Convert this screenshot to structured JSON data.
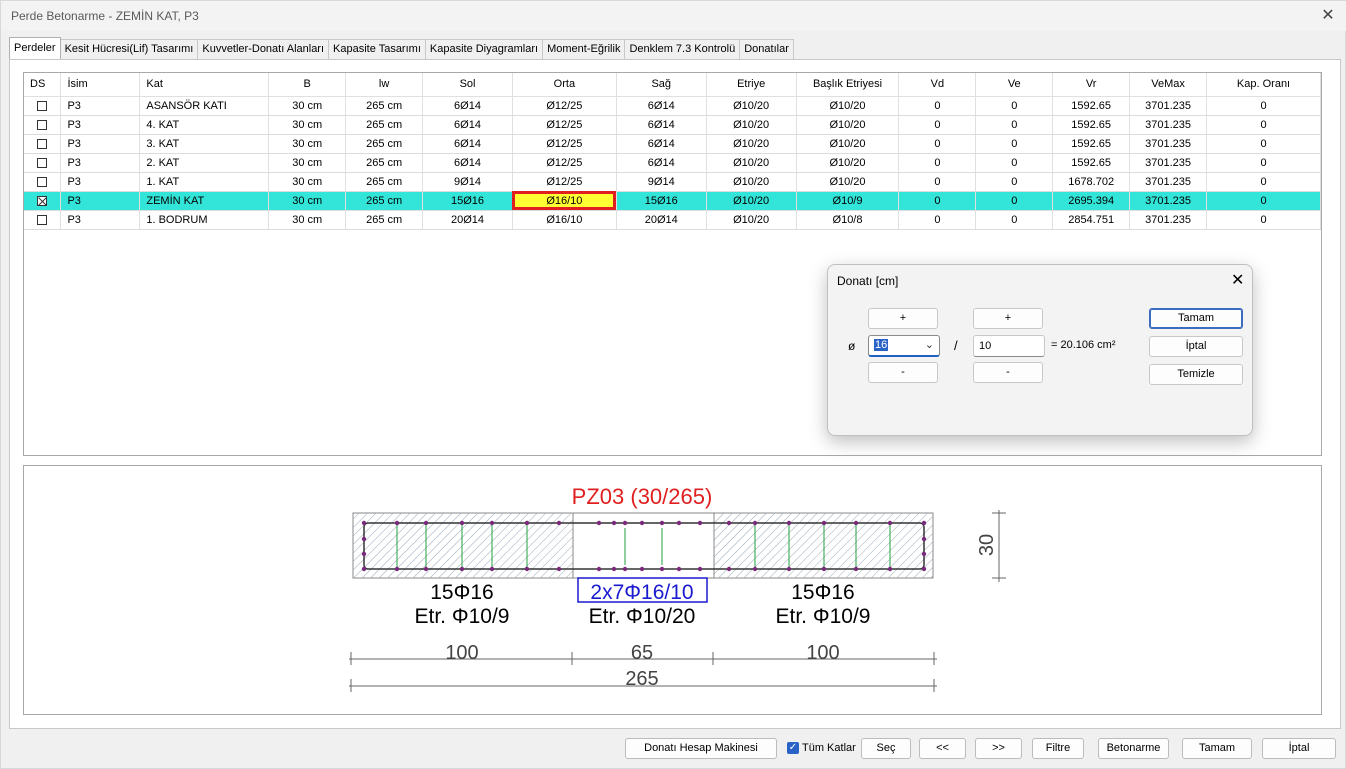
{
  "window": {
    "title": "Perde Betonarme - ZEMİN KAT, P3",
    "close_glyph": "✕"
  },
  "tabs": [
    "Perdeler",
    "Kesit Hücresi(Lif) Tasarımı",
    "Kuvvetler-Donatı Alanları",
    "Kapasite Tasarımı",
    "Kapasite Diyagramları",
    "Moment-Eğrilik",
    "Denklem 7.3 Kontrolü",
    "Donatılar"
  ],
  "grid": {
    "columns": [
      "DS",
      "İsim",
      "Kat",
      "B",
      "lw",
      "Sol",
      "Orta",
      "Sağ",
      "Etriye",
      "Başlık Etriyesi",
      "Vd",
      "Ve",
      "Vr",
      "VeMax",
      "Kap. Oranı"
    ],
    "rows": [
      {
        "ds": false,
        "cells": [
          "P3",
          "ASANSÖR KATI",
          "30 cm",
          "265 cm",
          "6Ø14",
          "Ø12/25",
          "6Ø14",
          "Ø10/20",
          "Ø10/20",
          "0",
          "0",
          "1592.65",
          "3701.235",
          "0"
        ]
      },
      {
        "ds": false,
        "cells": [
          "P3",
          "4. KAT",
          "30 cm",
          "265 cm",
          "6Ø14",
          "Ø12/25",
          "6Ø14",
          "Ø10/20",
          "Ø10/20",
          "0",
          "0",
          "1592.65",
          "3701.235",
          "0"
        ]
      },
      {
        "ds": false,
        "cells": [
          "P3",
          "3. KAT",
          "30 cm",
          "265 cm",
          "6Ø14",
          "Ø12/25",
          "6Ø14",
          "Ø10/20",
          "Ø10/20",
          "0",
          "0",
          "1592.65",
          "3701.235",
          "0"
        ]
      },
      {
        "ds": false,
        "cells": [
          "P3",
          "2. KAT",
          "30 cm",
          "265 cm",
          "6Ø14",
          "Ø12/25",
          "6Ø14",
          "Ø10/20",
          "Ø10/20",
          "0",
          "0",
          "1592.65",
          "3701.235",
          "0"
        ]
      },
      {
        "ds": false,
        "cells": [
          "P3",
          "1. KAT",
          "30 cm",
          "265 cm",
          "9Ø14",
          "Ø12/25",
          "9Ø14",
          "Ø10/20",
          "Ø10/20",
          "0",
          "0",
          "1678.702",
          "3701.235",
          "0"
        ]
      },
      {
        "ds": true,
        "selected": true,
        "cells": [
          "P3",
          "ZEMİN KAT",
          "30 cm",
          "265 cm",
          "15Ø16",
          "Ø16/10",
          "15Ø16",
          "Ø10/20",
          "Ø10/9",
          "0",
          "0",
          "2695.394",
          "3701.235",
          "0"
        ]
      },
      {
        "ds": false,
        "cells": [
          "P3",
          "1. BODRUM",
          "30 cm",
          "265 cm",
          "20Ø14",
          "Ø16/10",
          "20Ø14",
          "Ø10/20",
          "Ø10/8",
          "0",
          "0",
          "2854.751",
          "3701.235",
          "0"
        ]
      }
    ]
  },
  "drawing": {
    "title": "PZ03 (30/265)",
    "left_bar": "15Φ16",
    "left_stirrup": "Etr. Φ10/9",
    "mid_bar": "2x7Φ16/10",
    "mid_stirrup": "Etr. Φ10/20",
    "right_bar": "15Φ16",
    "right_stirrup": "Etr. Φ10/9",
    "dim_left": "100",
    "dim_mid": "65",
    "dim_right": "100",
    "dim_total": "265",
    "dim_thickness": "30",
    "colors": {
      "title": "#e02020",
      "mid_label": "#1a1ad0",
      "hatch": "#9aa8b8",
      "rebar": "#7a2a7a",
      "stirrup": "#20a040"
    }
  },
  "dialog": {
    "title": "Donatı  [cm]",
    "close_glyph": "✕",
    "plus": "+",
    "minus": "-",
    "phi_label": "ø",
    "diameter": "16",
    "slash": "/",
    "spacing": "10",
    "area_text": "= 20.106 cm²",
    "ok": "Tamam",
    "cancel": "İptal",
    "clear": "Temizle"
  },
  "bottom": {
    "calc": "Donatı Hesap Makinesi",
    "all_floors": "Tüm Katlar",
    "all_floors_checked": true,
    "select": "Seç",
    "prev": "<<",
    "next": ">>",
    "filter": "Filtre",
    "concrete": "Betonarme",
    "ok": "Tamam",
    "cancel": "İptal"
  }
}
